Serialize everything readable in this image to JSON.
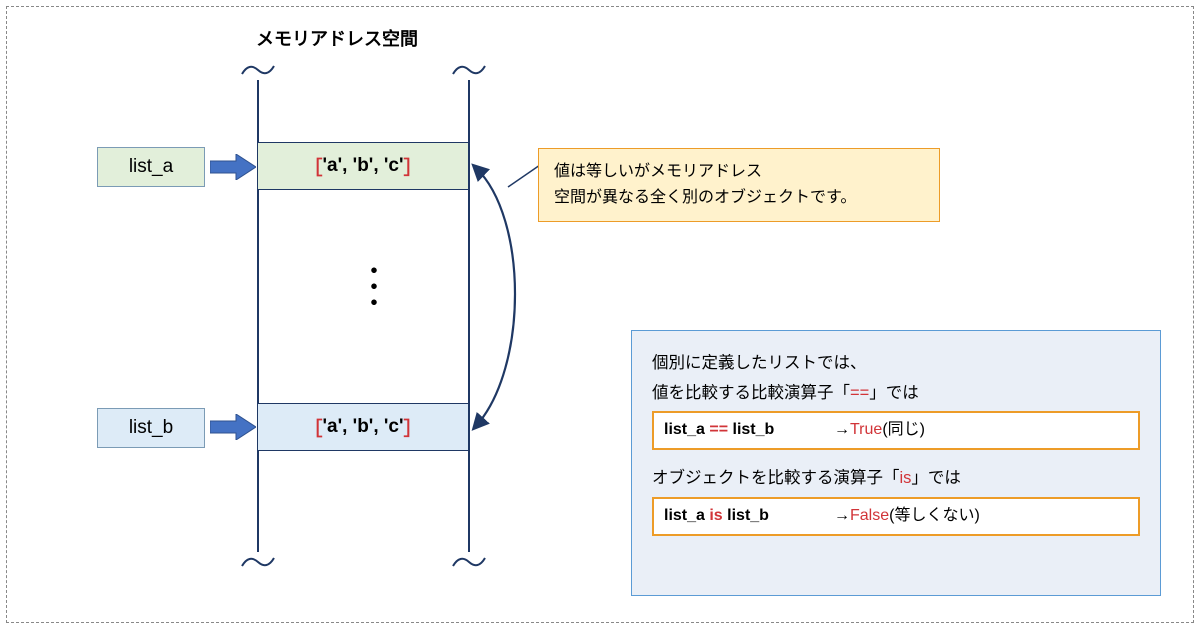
{
  "title": "メモリアドレス空間",
  "vars": {
    "a": "list_a",
    "b": "list_b"
  },
  "cell": {
    "open": "［",
    "close": "］",
    "content": "'a', 'b', 'c'"
  },
  "note": {
    "line1": "値は等しいがメモリアドレス",
    "line2": "空間が異なる全く別のオブジェクトです。"
  },
  "result": {
    "intro1": "個別に定義したリストでは、",
    "intro2_pre": "値を比較する比較演算子「",
    "intro2_op": "==",
    "intro2_post": "」では",
    "eq_code_pre": "list_a ",
    "eq_code_op": "==",
    "eq_code_post": " list_b",
    "eq_arrow": "→",
    "eq_result": "True",
    "eq_note": "(同じ)",
    "intro3_pre": "オブジェクトを比較する演算子「",
    "intro3_op": "is",
    "intro3_post": "」では",
    "is_code_pre": "list_a ",
    "is_code_op": "is",
    "is_code_post": " list_b",
    "is_arrow": "→",
    "is_result": "False",
    "is_note": "(等しくない)"
  }
}
